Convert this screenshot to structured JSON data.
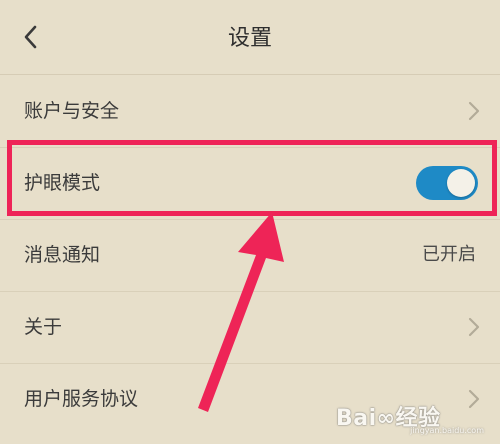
{
  "header": {
    "title": "设置",
    "back_icon": "chevron-left-icon"
  },
  "rows": [
    {
      "label": "账户与安全",
      "right": "chevron"
    },
    {
      "label": "护眼模式",
      "right": "toggle",
      "toggle_on": true
    },
    {
      "label": "消息通知",
      "right": "value",
      "value": "已开启"
    },
    {
      "label": "关于",
      "right": "chevron"
    },
    {
      "label": "用户服务协议",
      "right": "chevron"
    }
  ],
  "annotation": {
    "highlight_color": "#ee2457",
    "arrow_color": "#ee2457"
  },
  "watermark": {
    "text": "Bai∞经验",
    "sub": "jingyan.baidu.com"
  },
  "colors": {
    "background": "#e7dfca",
    "toggle_on": "#1e8ac6"
  }
}
